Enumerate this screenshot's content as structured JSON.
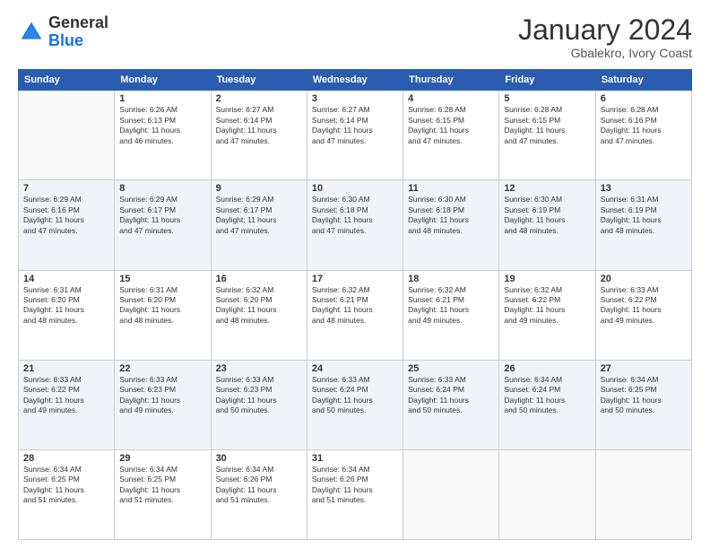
{
  "header": {
    "logo": {
      "line1": "General",
      "line2": "Blue"
    },
    "title": "January 2024",
    "subtitle": "Gbalekro, Ivory Coast"
  },
  "weekdays": [
    "Sunday",
    "Monday",
    "Tuesday",
    "Wednesday",
    "Thursday",
    "Friday",
    "Saturday"
  ],
  "weeks": [
    [
      {
        "day": "",
        "data": ""
      },
      {
        "day": "1",
        "data": "Sunrise: 6:26 AM\nSunset: 6:13 PM\nDaylight: 11 hours\nand 46 minutes."
      },
      {
        "day": "2",
        "data": "Sunrise: 6:27 AM\nSunset: 6:14 PM\nDaylight: 11 hours\nand 47 minutes."
      },
      {
        "day": "3",
        "data": "Sunrise: 6:27 AM\nSunset: 6:14 PM\nDaylight: 11 hours\nand 47 minutes."
      },
      {
        "day": "4",
        "data": "Sunrise: 6:28 AM\nSunset: 6:15 PM\nDaylight: 11 hours\nand 47 minutes."
      },
      {
        "day": "5",
        "data": "Sunrise: 6:28 AM\nSunset: 6:15 PM\nDaylight: 11 hours\nand 47 minutes."
      },
      {
        "day": "6",
        "data": "Sunrise: 6:28 AM\nSunset: 6:16 PM\nDaylight: 11 hours\nand 47 minutes."
      }
    ],
    [
      {
        "day": "7",
        "data": "Sunrise: 6:29 AM\nSunset: 6:16 PM\nDaylight: 11 hours\nand 47 minutes."
      },
      {
        "day": "8",
        "data": "Sunrise: 6:29 AM\nSunset: 6:17 PM\nDaylight: 11 hours\nand 47 minutes."
      },
      {
        "day": "9",
        "data": "Sunrise: 6:29 AM\nSunset: 6:17 PM\nDaylight: 11 hours\nand 47 minutes."
      },
      {
        "day": "10",
        "data": "Sunrise: 6:30 AM\nSunset: 6:18 PM\nDaylight: 11 hours\nand 47 minutes."
      },
      {
        "day": "11",
        "data": "Sunrise: 6:30 AM\nSunset: 6:18 PM\nDaylight: 11 hours\nand 48 minutes."
      },
      {
        "day": "12",
        "data": "Sunrise: 6:30 AM\nSunset: 6:19 PM\nDaylight: 11 hours\nand 48 minutes."
      },
      {
        "day": "13",
        "data": "Sunrise: 6:31 AM\nSunset: 6:19 PM\nDaylight: 11 hours\nand 48 minutes."
      }
    ],
    [
      {
        "day": "14",
        "data": "Sunrise: 6:31 AM\nSunset: 6:20 PM\nDaylight: 11 hours\nand 48 minutes."
      },
      {
        "day": "15",
        "data": "Sunrise: 6:31 AM\nSunset: 6:20 PM\nDaylight: 11 hours\nand 48 minutes."
      },
      {
        "day": "16",
        "data": "Sunrise: 6:32 AM\nSunset: 6:20 PM\nDaylight: 11 hours\nand 48 minutes."
      },
      {
        "day": "17",
        "data": "Sunrise: 6:32 AM\nSunset: 6:21 PM\nDaylight: 11 hours\nand 48 minutes."
      },
      {
        "day": "18",
        "data": "Sunrise: 6:32 AM\nSunset: 6:21 PM\nDaylight: 11 hours\nand 49 minutes."
      },
      {
        "day": "19",
        "data": "Sunrise: 6:32 AM\nSunset: 6:22 PM\nDaylight: 11 hours\nand 49 minutes."
      },
      {
        "day": "20",
        "data": "Sunrise: 6:33 AM\nSunset: 6:22 PM\nDaylight: 11 hours\nand 49 minutes."
      }
    ],
    [
      {
        "day": "21",
        "data": "Sunrise: 6:33 AM\nSunset: 6:22 PM\nDaylight: 11 hours\nand 49 minutes."
      },
      {
        "day": "22",
        "data": "Sunrise: 6:33 AM\nSunset: 6:23 PM\nDaylight: 11 hours\nand 49 minutes."
      },
      {
        "day": "23",
        "data": "Sunrise: 6:33 AM\nSunset: 6:23 PM\nDaylight: 11 hours\nand 50 minutes."
      },
      {
        "day": "24",
        "data": "Sunrise: 6:33 AM\nSunset: 6:24 PM\nDaylight: 11 hours\nand 50 minutes."
      },
      {
        "day": "25",
        "data": "Sunrise: 6:33 AM\nSunset: 6:24 PM\nDaylight: 11 hours\nand 50 minutes."
      },
      {
        "day": "26",
        "data": "Sunrise: 6:34 AM\nSunset: 6:24 PM\nDaylight: 11 hours\nand 50 minutes."
      },
      {
        "day": "27",
        "data": "Sunrise: 6:34 AM\nSunset: 6:25 PM\nDaylight: 11 hours\nand 50 minutes."
      }
    ],
    [
      {
        "day": "28",
        "data": "Sunrise: 6:34 AM\nSunset: 6:25 PM\nDaylight: 11 hours\nand 51 minutes."
      },
      {
        "day": "29",
        "data": "Sunrise: 6:34 AM\nSunset: 6:25 PM\nDaylight: 11 hours\nand 51 minutes."
      },
      {
        "day": "30",
        "data": "Sunrise: 6:34 AM\nSunset: 6:26 PM\nDaylight: 11 hours\nand 51 minutes."
      },
      {
        "day": "31",
        "data": "Sunrise: 6:34 AM\nSunset: 6:26 PM\nDaylight: 11 hours\nand 51 minutes."
      },
      {
        "day": "",
        "data": ""
      },
      {
        "day": "",
        "data": ""
      },
      {
        "day": "",
        "data": ""
      }
    ]
  ]
}
